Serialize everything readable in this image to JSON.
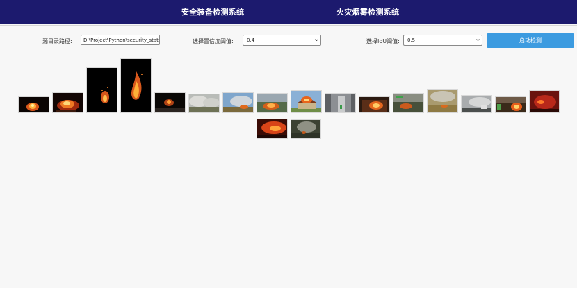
{
  "header": {
    "nav_items": [
      {
        "label": "安全装备检测系统"
      },
      {
        "label": "火灾烟雾检测系统"
      }
    ],
    "background_color": "#1c1a6e"
  },
  "controls": {
    "source_dir_label": "源目录路径:",
    "source_dir_value": "D:\\Project\\Python\\security_status",
    "confidence_label": "选择置信度阈值:",
    "confidence_value": "0.4",
    "iou_label": "选择IoU阈值:",
    "iou_value": "0.5",
    "start_button_label": "启动检测",
    "accent_color": "#3c9be0"
  },
  "gallery": {
    "images": [
      {
        "name": "fire-thumb-1",
        "scene": "small campfire at night"
      },
      {
        "name": "fire-thumb-2",
        "scene": "burning logs at night"
      },
      {
        "name": "fire-thumb-3",
        "scene": "fire in darkness"
      },
      {
        "name": "fire-thumb-4",
        "scene": "tall flame in darkness"
      },
      {
        "name": "fire-thumb-5",
        "scene": "dim fire at night"
      },
      {
        "name": "smoke-thumb-6",
        "scene": "smoky field"
      },
      {
        "name": "smoke-thumb-7",
        "scene": "grass fire with blue sky"
      },
      {
        "name": "fire-thumb-8",
        "scene": "burning vegetation"
      },
      {
        "name": "fire-thumb-9",
        "scene": "burning house"
      },
      {
        "name": "smoke-thumb-10",
        "scene": "smoky corridor"
      },
      {
        "name": "fire-thumb-11",
        "scene": "building fire"
      },
      {
        "name": "fire-thumb-12",
        "scene": "field fire with caption"
      },
      {
        "name": "smoke-thumb-13",
        "scene": "dry grass smoke"
      },
      {
        "name": "smoke-thumb-14",
        "scene": "smoke over road"
      },
      {
        "name": "fire-thumb-15",
        "scene": "fire in yard"
      },
      {
        "name": "fire-thumb-16",
        "scene": "red burning room"
      },
      {
        "name": "fire-thumb-17",
        "scene": "orange fire night street"
      },
      {
        "name": "smoke-thumb-18",
        "scene": "forest smoke"
      }
    ]
  }
}
